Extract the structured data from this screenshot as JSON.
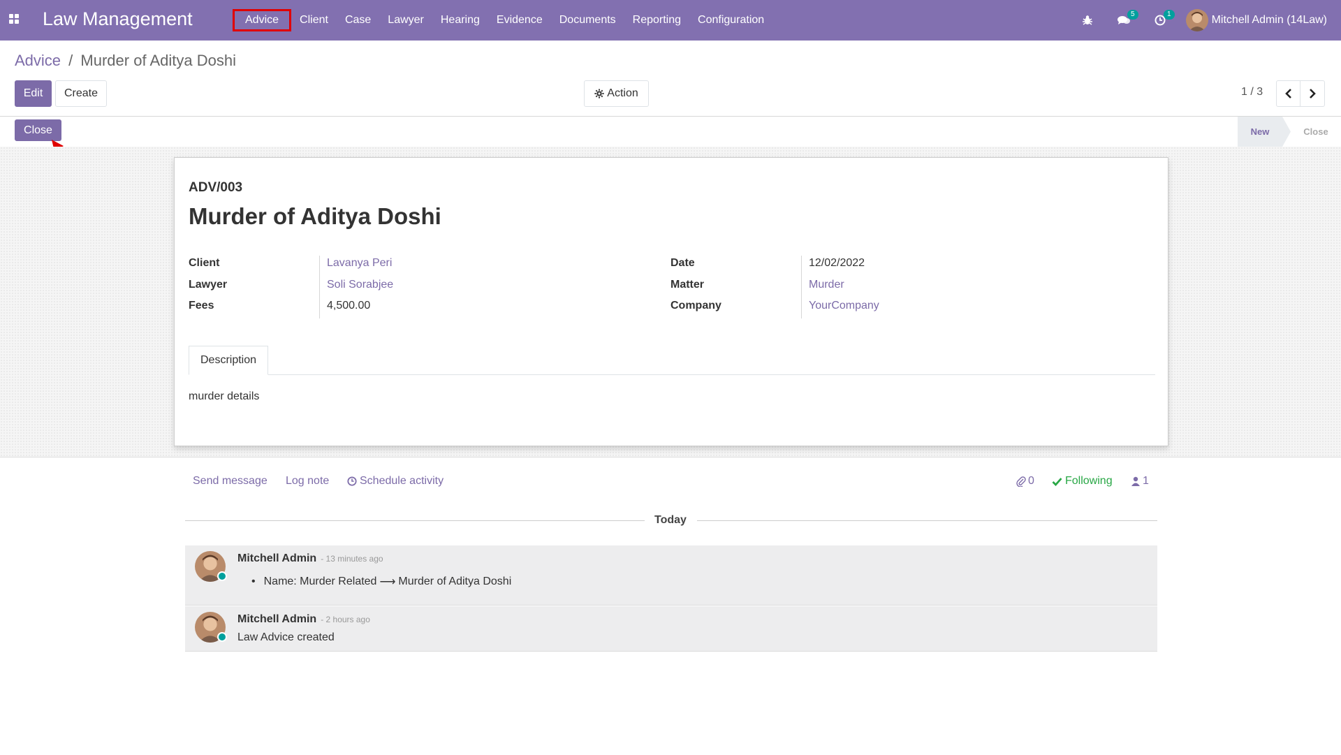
{
  "navbar": {
    "brand": "Law Management",
    "menu": [
      "Advice",
      "Client",
      "Case",
      "Lawyer",
      "Hearing",
      "Evidence",
      "Documents",
      "Reporting",
      "Configuration"
    ],
    "messages_count": "5",
    "activities_count": "1",
    "user_name": "Mitchell Admin (14Law)"
  },
  "breadcrumb": {
    "parent": "Advice",
    "separator": "/",
    "current": "Murder of Aditya Doshi"
  },
  "toolbar": {
    "edit_label": "Edit",
    "create_label": "Create",
    "action_label": "Action",
    "pager": "1 / 3"
  },
  "statusbar": {
    "close_button": "Close",
    "stages": [
      "New",
      "Close"
    ],
    "current_stage": "New"
  },
  "record": {
    "reference": "ADV/003",
    "name": "Murder of Aditya Doshi",
    "left_fields": [
      {
        "label": "Client",
        "value": "Lavanya Peri"
      },
      {
        "label": "Lawyer",
        "value": "Soli Sorabjee"
      },
      {
        "label": "Fees",
        "value": "4,500.00"
      }
    ],
    "right_fields": [
      {
        "label": "Date",
        "value": "12/02/2022"
      },
      {
        "label": "Matter",
        "value": "Murder"
      },
      {
        "label": "Company",
        "value": "YourCompany"
      }
    ],
    "tab": "Description",
    "description": "murder details"
  },
  "chatter": {
    "send_message": "Send message",
    "log_note": "Log note",
    "schedule_activity": "Schedule activity",
    "attachments": "0",
    "following": "Following",
    "followers": "1",
    "date_separator": "Today",
    "messages": [
      {
        "author": "Mitchell Admin",
        "time": "- 13 minutes ago",
        "body": "Name: Murder Related",
        "arrow": "⟶",
        "new_value": "Murder of Aditya Doshi"
      },
      {
        "author": "Mitchell Admin",
        "time": "- 2 hours ago",
        "body": "Law Advice created"
      }
    ]
  },
  "colors": {
    "brand": "#8270b0",
    "accent": "#7c6ba8",
    "highlight": "#e00000",
    "online": "#00a09d",
    "following": "#28a745"
  }
}
